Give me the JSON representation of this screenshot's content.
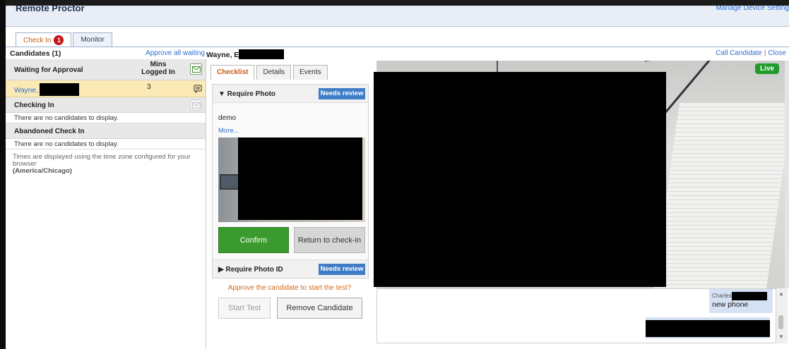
{
  "app": {
    "title": "Remote Proctor",
    "manage_link": "Manage Device Setting"
  },
  "tabs": [
    {
      "label": "Check In",
      "badge": "1",
      "active": true
    },
    {
      "label": "Monitor",
      "active": false
    }
  ],
  "candidates": {
    "header": "Candidates (1)",
    "approve_all": "Approve all waiting",
    "selected_name_prefix": "Wayne, E",
    "call_candidate": "Call Candidate",
    "close": "Close",
    "waiting_section": "Waiting for Approval",
    "mins_logged_in": "Mins Logged In",
    "rows": [
      {
        "name": "Wayne,",
        "mins": "3"
      }
    ],
    "checking_in_section": "Checking In",
    "checking_in_empty": "There are no candidates to display.",
    "abandoned_section": "Abandoned Check In",
    "abandoned_empty": "There are no candidates to display.",
    "tz_note": "Times are displayed using the time zone configured for your browser",
    "tz_value": "(America/Chicago)"
  },
  "detail": {
    "subtabs": [
      "Checklist",
      "Details",
      "Events"
    ],
    "require_photo": "▼ Require Photo",
    "needs_review": "Needs review",
    "demo_text": "demo",
    "more_link": "More...",
    "confirm_label": "Confirm",
    "return_label": "Return to check-in",
    "require_photo_id": "▶ Require Photo ID",
    "needs_review_2": "Needs review",
    "approve_hint": "Approve the candidate to start the test?",
    "start_test": "Start Test",
    "remove_candidate": "Remove Candidate"
  },
  "video": {
    "live_label": "Live"
  },
  "chat": {
    "messages": [
      {
        "from": "Charles",
        "text": "new phone"
      }
    ]
  },
  "colors": {
    "accent_orange": "#c95a17",
    "link_blue": "#2f6fd1",
    "confirm_green": "#3b9a2e",
    "live_green": "#1f9a2b",
    "badge_red": "#c9151d",
    "review_blue": "#3f7ec7"
  }
}
